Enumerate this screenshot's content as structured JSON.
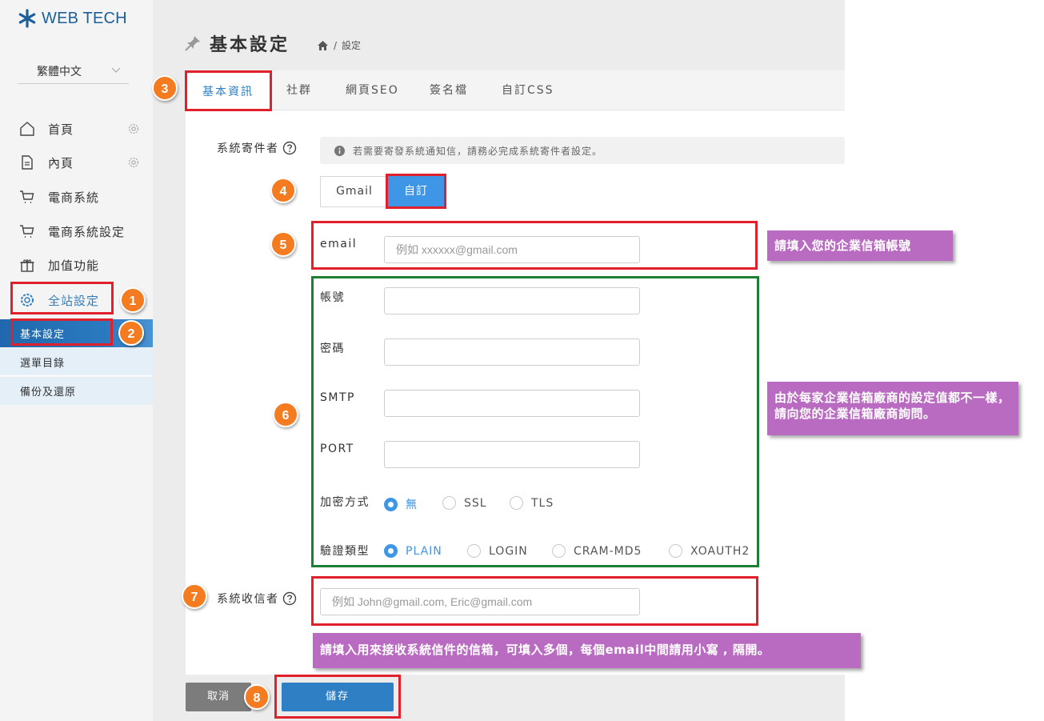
{
  "brand": {
    "name": "WEB TECH",
    "color": "#1d5f98"
  },
  "language": {
    "selected": "繁體中文"
  },
  "sidebar": {
    "items": [
      {
        "label": "首頁",
        "icon": "home-icon",
        "has_settings": true
      },
      {
        "label": "內頁",
        "icon": "document-icon",
        "has_settings": true
      },
      {
        "label": "電商系統",
        "icon": "cart-icon"
      },
      {
        "label": "電商系統設定",
        "icon": "cart-icon"
      },
      {
        "label": "加值功能",
        "icon": "gift-icon"
      },
      {
        "label": "全站設定",
        "icon": "gear-icon",
        "active": true
      }
    ],
    "subitems": [
      {
        "label": "基本設定",
        "active": true
      },
      {
        "label": "選單目錄"
      },
      {
        "label": "備份及還原"
      }
    ]
  },
  "header": {
    "title": "基本設定",
    "breadcrumb": {
      "separator": "/",
      "current": "設定"
    }
  },
  "tabs": [
    {
      "label": "基本資訊",
      "active": true
    },
    {
      "label": "社群"
    },
    {
      "label": "網頁SEO"
    },
    {
      "label": "簽名檔"
    },
    {
      "label": "自訂CSS"
    }
  ],
  "form": {
    "sender_label": "系統寄件者",
    "notice": "若需要寄發系統通知信，請務必完成系統寄件者設定。",
    "mode_options": [
      "Gmail",
      "自訂"
    ],
    "mode_selected": "自訂",
    "email": {
      "label": "email",
      "placeholder": "例如 xxxxxx@gmail.com"
    },
    "account": {
      "label": "帳號",
      "value": ""
    },
    "password": {
      "label": "密碼",
      "value": ""
    },
    "smtp": {
      "label": "SMTP",
      "value": ""
    },
    "port": {
      "label": "PORT",
      "value": ""
    },
    "encryption": {
      "label": "加密方式",
      "options": [
        "無",
        "SSL",
        "TLS"
      ],
      "selected": "無"
    },
    "auth": {
      "label": "驗證類型",
      "options": [
        "PLAIN",
        "LOGIN",
        "CRAM-MD5",
        "XOAUTH2"
      ],
      "selected": "PLAIN"
    },
    "recipient": {
      "label": "系統收信者",
      "placeholder": "例如 John@gmail.com, Eric@gmail.com"
    }
  },
  "buttons": {
    "cancel": "取消",
    "save": "儲存"
  },
  "annotations": {
    "badges": [
      "1",
      "2",
      "3",
      "4",
      "5",
      "6",
      "7",
      "8"
    ],
    "callout_email": "請填入您的企業信箱帳號",
    "callout_vendor": "由於每家企業信箱廠商的設定值都不一樣，請向您的企業信箱廠商詢問。",
    "callout_recipient": "請填入用來接收系統信件的信箱，可填入多個，每個email中間請用小寫 , 隔開。"
  },
  "colors": {
    "accent": "#3f95e6",
    "annotation_red": "#e0212b",
    "annotation_green": "#1c7f33",
    "badge_orange": "#f47b20",
    "callout_purple": "#b96bc1"
  }
}
